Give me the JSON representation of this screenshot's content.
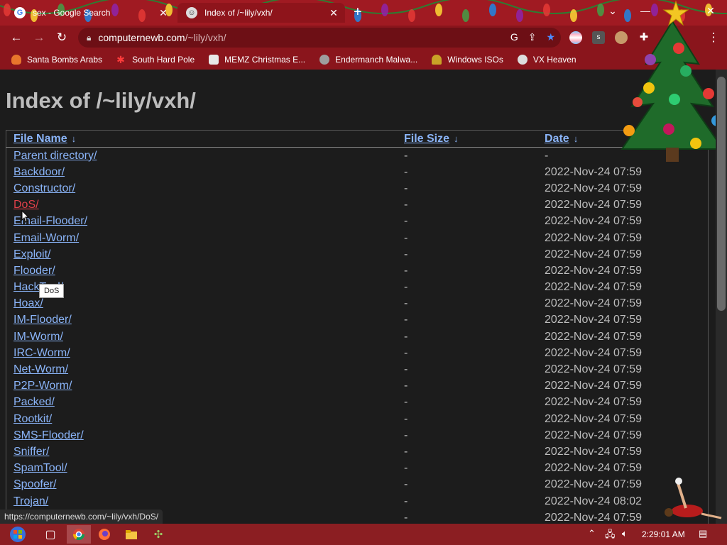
{
  "tabs": [
    {
      "title": "sex - Google Search",
      "icon": "google-icon"
    },
    {
      "title": "Index of /~lily/vxh/",
      "icon": "page-icon"
    }
  ],
  "address": {
    "host": "computernewb.com",
    "path": "/~lily/vxh/"
  },
  "bookmarks": [
    {
      "label": "Santa Bombs Arabs",
      "icon": "fire-icon"
    },
    {
      "label": "South Hard Pole",
      "icon": "snowflake-icon"
    },
    {
      "label": "MEMZ Christmas E...",
      "icon": "image-icon"
    },
    {
      "label": "Endermanch Malwa...",
      "icon": "raccoon-icon"
    },
    {
      "label": "Windows ISOs",
      "icon": "person-icon"
    },
    {
      "label": "VX Heaven",
      "icon": "virus-icon"
    }
  ],
  "page": {
    "title": "Index of /~lily/vxh/",
    "columns": {
      "name": "File Name",
      "size": "File Size",
      "date": "Date",
      "sort_arrow": "↓"
    },
    "rows": [
      {
        "name": "Parent directory/",
        "size": "-",
        "date": "-"
      },
      {
        "name": "Backdoor/",
        "size": "-",
        "date": "2022-Nov-24 07:59"
      },
      {
        "name": "Constructor/",
        "size": "-",
        "date": "2022-Nov-24 07:59"
      },
      {
        "name": "DoS/",
        "size": "-",
        "date": "2022-Nov-24 07:59",
        "hover": true
      },
      {
        "name": "Email-Flooder/",
        "size": "-",
        "date": "2022-Nov-24 07:59"
      },
      {
        "name": "Email-Worm/",
        "size": "-",
        "date": "2022-Nov-24 07:59"
      },
      {
        "name": "Exploit/",
        "size": "-",
        "date": "2022-Nov-24 07:59"
      },
      {
        "name": "Flooder/",
        "size": "-",
        "date": "2022-Nov-24 07:59"
      },
      {
        "name": "HackTool/",
        "size": "-",
        "date": "2022-Nov-24 07:59"
      },
      {
        "name": "Hoax/",
        "size": "-",
        "date": "2022-Nov-24 07:59"
      },
      {
        "name": "IM-Flooder/",
        "size": "-",
        "date": "2022-Nov-24 07:59"
      },
      {
        "name": "IM-Worm/",
        "size": "-",
        "date": "2022-Nov-24 07:59"
      },
      {
        "name": "IRC-Worm/",
        "size": "-",
        "date": "2022-Nov-24 07:59"
      },
      {
        "name": "Net-Worm/",
        "size": "-",
        "date": "2022-Nov-24 07:59"
      },
      {
        "name": "P2P-Worm/",
        "size": "-",
        "date": "2022-Nov-24 07:59"
      },
      {
        "name": "Packed/",
        "size": "-",
        "date": "2022-Nov-24 07:59"
      },
      {
        "name": "Rootkit/",
        "size": "-",
        "date": "2022-Nov-24 07:59"
      },
      {
        "name": "SMS-Flooder/",
        "size": "-",
        "date": "2022-Nov-24 07:59"
      },
      {
        "name": "Sniffer/",
        "size": "-",
        "date": "2022-Nov-24 07:59"
      },
      {
        "name": "SpamTool/",
        "size": "-",
        "date": "2022-Nov-24 07:59"
      },
      {
        "name": "Spoofer/",
        "size": "-",
        "date": "2022-Nov-24 07:59"
      },
      {
        "name": "Trojan/",
        "size": "-",
        "date": "2022-Nov-24 08:02"
      },
      {
        "name": "",
        "size": "-",
        "date": "2022-Nov-24 07:59"
      }
    ]
  },
  "tooltip": "DoS",
  "status_url": "https://computernewb.com/~lily/vxh/DoS/",
  "taskbar": {
    "clock": "2:29:01 AM"
  },
  "colors": {
    "link": "#8ab4f8",
    "hover_link": "#e0404a",
    "chrome": "#8a151c"
  }
}
